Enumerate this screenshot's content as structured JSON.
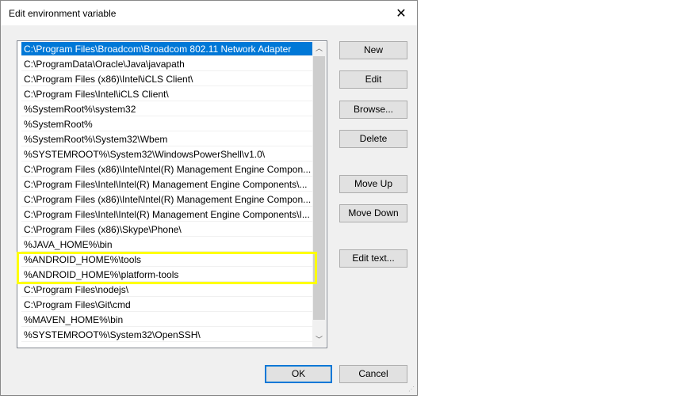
{
  "dialog": {
    "title": "Edit environment variable"
  },
  "paths": [
    "C:\\Program Files\\Broadcom\\Broadcom 802.11 Network Adapter",
    "C:\\ProgramData\\Oracle\\Java\\javapath",
    "C:\\Program Files (x86)\\Intel\\iCLS Client\\",
    "C:\\Program Files\\Intel\\iCLS Client\\",
    "%SystemRoot%\\system32",
    "%SystemRoot%",
    "%SystemRoot%\\System32\\Wbem",
    "%SYSTEMROOT%\\System32\\WindowsPowerShell\\v1.0\\",
    "C:\\Program Files (x86)\\Intel\\Intel(R) Management Engine Compon...",
    "C:\\Program Files\\Intel\\Intel(R) Management Engine Components\\...",
    "C:\\Program Files (x86)\\Intel\\Intel(R) Management Engine Compon...",
    "C:\\Program Files\\Intel\\Intel(R) Management Engine Components\\I...",
    "C:\\Program Files (x86)\\Skype\\Phone\\",
    "%JAVA_HOME%\\bin",
    "%ANDROID_HOME%\\tools",
    "%ANDROID_HOME%\\platform-tools",
    "C:\\Program Files\\nodejs\\",
    "C:\\Program Files\\Git\\cmd",
    "%MAVEN_HOME%\\bin",
    "%SYSTEMROOT%\\System32\\OpenSSH\\"
  ],
  "selected_index": 0,
  "highlight_color": "#ffff00",
  "accent_color": "#0078d7",
  "buttons": {
    "new": "New",
    "edit": "Edit",
    "browse": "Browse...",
    "delete": "Delete",
    "move_up": "Move Up",
    "move_down": "Move Down",
    "edit_text": "Edit text...",
    "ok": "OK",
    "cancel": "Cancel"
  }
}
